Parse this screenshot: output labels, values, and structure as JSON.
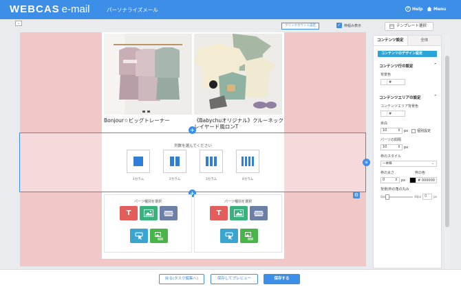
{
  "header": {
    "logo_main": "WEBCAS",
    "logo_sub": "e-mail",
    "title": "パーソナライズメール",
    "help_label": "Help",
    "menu_label": "Menu",
    "bg_color": "#3d8ee6"
  },
  "toolbar": {
    "collapse_glyph": "⌄",
    "click_count_label": "クリックカウント設定",
    "frame_display_label": "枠組み表示",
    "template_select_label": "テンプレート選択"
  },
  "products": [
    {
      "caption": "Bonjour☆ビッグトレーナー"
    },
    {
      "caption": "《Babychuオリジナル》クルーネック"
    },
    {
      "caption": "レイヤード風ロンT"
    }
  ],
  "column_selector": {
    "title": "列数を選んでください",
    "options": [
      {
        "label": "1カラム",
        "bars": 1
      },
      {
        "label": "2カラム",
        "bars": 2
      },
      {
        "label": "3カラム",
        "bars": 3
      },
      {
        "label": "4カラム",
        "bars": 4
      }
    ]
  },
  "parts": {
    "title_left": "パーツ種別を選択",
    "title_right": "パーツ種別を選択",
    "colors": {
      "text": "#e35d5b",
      "image": "#3bb27e",
      "divider": "#6c7fa6",
      "button": "#3aa6cf",
      "imagetext": "#49b548"
    },
    "text_glyph": "T"
  },
  "footer": {
    "back_label": "戻る(タスク編集へ)",
    "preview_label": "保存してプレビュー",
    "save_label": "保存する"
  },
  "panel": {
    "tab_content": "コンテンツ設定",
    "tab_all": "全体",
    "banner": "コンテンツのデザイン設定",
    "row_section": "コンテンツ行の設定",
    "bg_color_label": "背景色",
    "bg_color_value": "#",
    "area_section": "コンテンツエリアの設定",
    "area_bg_label": "コンテンツエリア背景色",
    "area_bg_value": "#",
    "margin_label": "余白",
    "margin_value": "10",
    "margin_unit": "px",
    "individual_label": "個別設定",
    "parts_gap_label": "パーツの間隔",
    "parts_gap_value": "10",
    "parts_gap_unit": "px",
    "border_style_label": "枠のスタイル",
    "border_style_value": "一本線",
    "border_width_label": "枠の太さ",
    "border_width_value": "0",
    "border_width_unit": "px",
    "border_color_label": "枠の色",
    "border_color_value": "# 000000",
    "corner_label": "背景|枠の角の丸み",
    "corner_min": "0px",
    "corner_max": "40px",
    "corner_value": "0",
    "corner_unit": "px",
    "corner_level": 0
  }
}
